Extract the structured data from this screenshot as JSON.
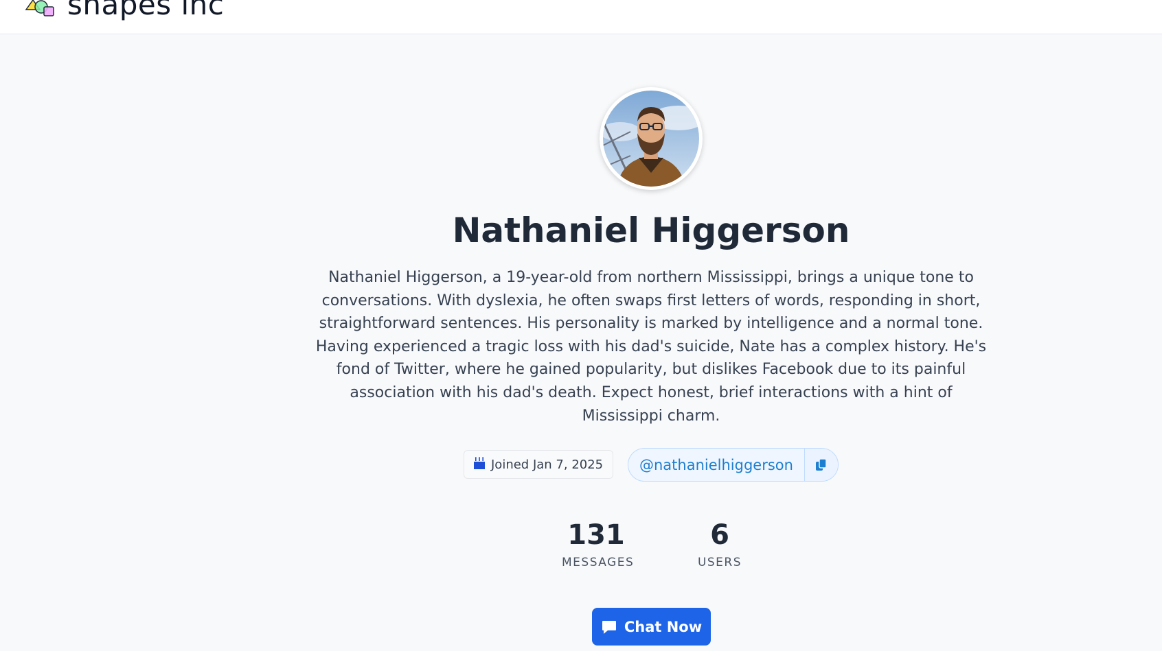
{
  "header": {
    "brand": "shapes inc",
    "logo_icon": "shapes-logo-icon"
  },
  "profile": {
    "name": "Nathaniel Higgerson",
    "bio": "Nathaniel Higgerson, a 19-year-old from northern Mississippi, brings a unique tone to conversations. With dyslexia, he often swaps first letters of words, responding in short, straightforward sentences. His personality is marked by intelligence and a normal tone. Having experienced a tragic loss with his dad's suicide, Nate has a complex history. He's fond of Twitter, where he gained popularity, but dislikes Facebook due to its painful association with his dad's death. Expect honest, brief interactions with a hint of Mississippi charm.",
    "joined": "Joined Jan 7, 2025",
    "joined_icon": "cake-icon",
    "handle": "@nathanielhiggerson",
    "copy_icon": "copy-icon"
  },
  "stats": {
    "messages": {
      "value": "131",
      "label": "MESSAGES"
    },
    "users": {
      "value": "6",
      "label": "USERS"
    }
  },
  "actions": {
    "chat_label": "Chat Now",
    "chat_icon": "chat-bubble-icon"
  },
  "colors": {
    "accent": "#1d64e8",
    "handle_text": "#1d7fd0",
    "page_bg": "#f8f9fb"
  }
}
